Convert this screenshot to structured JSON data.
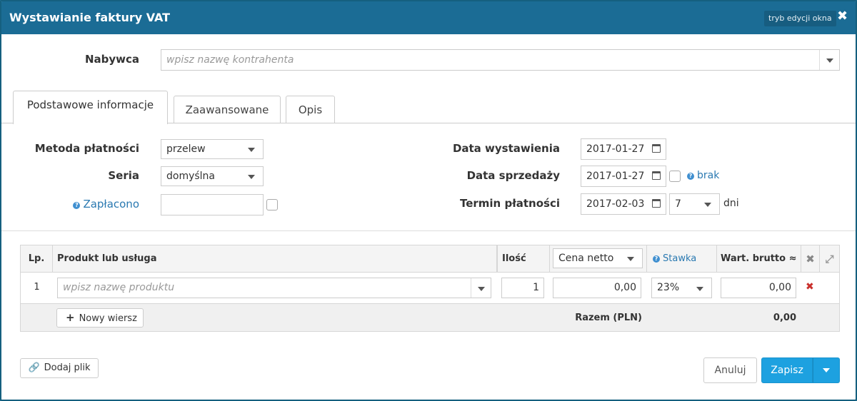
{
  "window": {
    "title": "Wystawianie faktury VAT",
    "edit_mode": "tryb edycji okna",
    "close_glyph": "✖"
  },
  "buyer": {
    "label": "Nabywca",
    "placeholder": "wpisz nazwę kontrahenta"
  },
  "tabs": [
    {
      "label": "Podstawowe informacje",
      "active": true
    },
    {
      "label": "Zaawansowane",
      "active": false
    },
    {
      "label": "Opis",
      "active": false
    }
  ],
  "left": {
    "payment_method": {
      "label": "Metoda płatności",
      "value": "przelew"
    },
    "series": {
      "label": "Seria",
      "value": "domyślna"
    },
    "paid": {
      "label": "Zapłacono",
      "value": ""
    }
  },
  "right": {
    "issue_date": {
      "label": "Data wystawienia",
      "value": "2017-01-27"
    },
    "sale_date": {
      "label": "Data sprzedaży",
      "value": "2017-01-27",
      "none_link": "brak"
    },
    "due_date": {
      "label": "Termin płatności",
      "value": "2017-02-03",
      "days": "7",
      "days_unit": "dni"
    }
  },
  "grid": {
    "headers": {
      "lp": "Lp.",
      "product": "Produkt lub usługa",
      "qty": "Ilość",
      "net_price": "Cena netto",
      "rate": "Stawka",
      "gross": "Wart. brutto ≈"
    },
    "rows": [
      {
        "lp": "1",
        "product_placeholder": "wpisz nazwę produktu",
        "qty": "1",
        "net_price": "0,00",
        "rate": "23%",
        "gross": "0,00"
      }
    ],
    "new_row": "Nowy wiersz",
    "total_label": "Razem (PLN)",
    "total_value": "0,00"
  },
  "footer": {
    "add_file": "Dodaj plik",
    "cancel": "Anuluj",
    "save": "Zapisz"
  },
  "colors": {
    "titlebar": "#1b6c95",
    "primary": "#1da1e0",
    "link": "#2a79b1",
    "delete": "#c9302c"
  }
}
